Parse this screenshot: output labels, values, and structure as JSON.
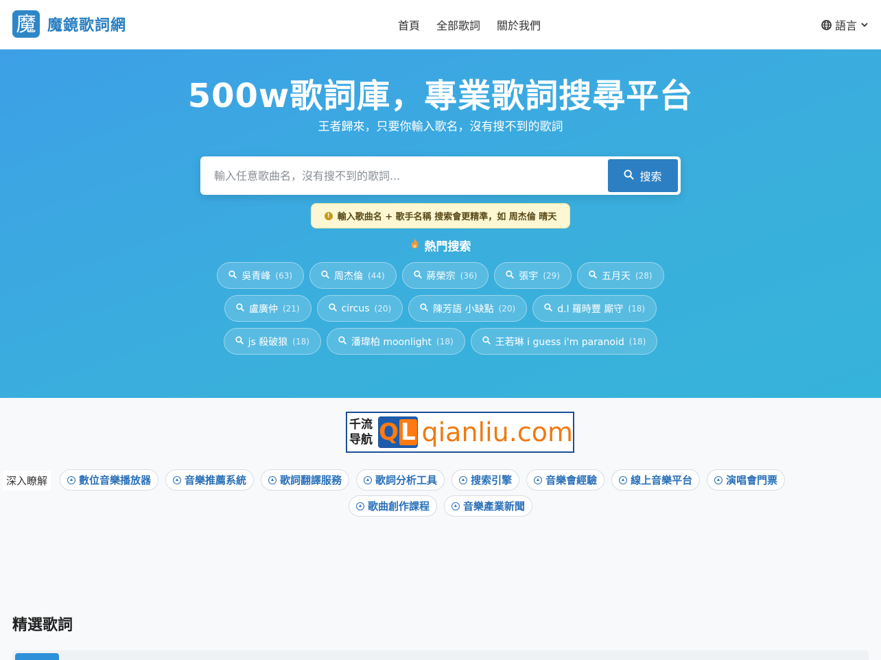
{
  "header": {
    "logo_char": "魔",
    "brand": "魔鏡歌詞網",
    "nav": [
      "首頁",
      "全部歌詞",
      "關於我們"
    ],
    "language": "語言"
  },
  "hero": {
    "title": "500w歌詞庫，專業歌詞搜尋平台",
    "subtitle": "王者歸來，只要你輸入歌名，沒有搜不到的歌詞",
    "search": {
      "placeholder": "輸入任意歌曲名，沒有搜不到的歌詞...",
      "value": "",
      "button": "搜索"
    },
    "tip": "輸入歌曲名 + 歌手名稱 搜索會更精準，如 周杰倫 晴天",
    "hot_title": "熱門搜索",
    "hot_searches": [
      {
        "term": "吳青峰",
        "count": "(63)"
      },
      {
        "term": "周杰倫",
        "count": "(44)"
      },
      {
        "term": "蔣榮宗",
        "count": "(36)"
      },
      {
        "term": "張宇",
        "count": "(29)"
      },
      {
        "term": "五月天",
        "count": "(28)"
      },
      {
        "term": "盧廣仲",
        "count": "(21)"
      },
      {
        "term": "circus",
        "count": "(20)"
      },
      {
        "term": "陳芳語 小缺點",
        "count": "(20)"
      },
      {
        "term": "d.l 羅時豐 廝守",
        "count": "(18)"
      },
      {
        "term": "js 殺破狼",
        "count": "(18)"
      },
      {
        "term": "潘瑋柏 moonlight",
        "count": "(18)"
      },
      {
        "term": "王若琳 i guess i'm paranoid",
        "count": "(18)"
      }
    ]
  },
  "ad": {
    "left_line1": "千流",
    "left_line2": "导航",
    "logo_q": "Q",
    "logo_l": "L",
    "domain": "qianliu.com"
  },
  "explore": {
    "label": "深入瞭解",
    "tags": [
      "數位音樂播放器",
      "音樂推薦系統",
      "歌詞翻譯服務",
      "歌詞分析工具",
      "搜索引擎",
      "音樂會經驗",
      "線上音樂平台",
      "演唱會門票",
      "歌曲創作課程",
      "音樂產業新聞"
    ]
  },
  "featured": {
    "title": "精選歌詞"
  },
  "colors": {
    "brand": "#2a7fc1",
    "search_button": "#2c7fc2",
    "tip_background": "#fdf7d3",
    "hot_icon": "#f39a3c"
  }
}
